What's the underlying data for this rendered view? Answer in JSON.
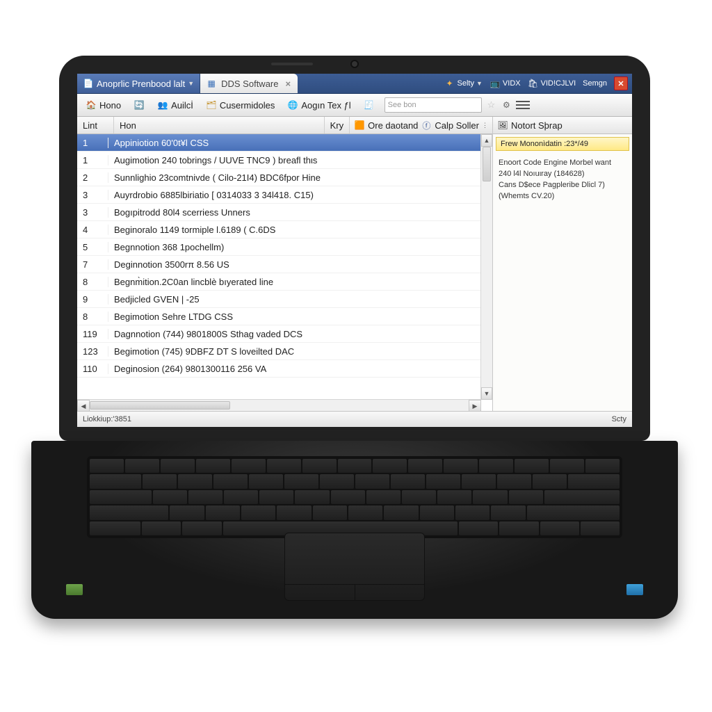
{
  "tabs": {
    "bg_label": "Anoprlic Prenbood lalt",
    "active_label": "DDS Software",
    "right_items": [
      "Selty",
      "VIDX",
      "VID!CJLVI",
      "Semgn"
    ]
  },
  "toolbar": {
    "home": "Hono",
    "audit": "Auilcİ",
    "customers": "Cusermidoles",
    "agentext": "Aogın Tex ƒl",
    "search_placeholder": "See bon"
  },
  "grid": {
    "headers": {
      "col1": "Lint",
      "col2": "Hon",
      "key": "Kry",
      "ore": "Ore daotand",
      "calp": "Calp Soller"
    },
    "rows": [
      {
        "n": "1",
        "t": "Appiniotion 60'0t¥l CSS",
        "sel": true
      },
      {
        "n": "1",
        "t": "Augimotion 240 tobrings / UUVE TNC9 ) breafl thιs"
      },
      {
        "n": "2",
        "t": "Sunnlighio 23comtnivde ( Cilo-21I4) BDC6fpor Hine"
      },
      {
        "n": "3",
        "t": "Auyrdrobio 6885lbiriatio [ 0314033 3 34l418. C15)"
      },
      {
        "n": "3",
        "t": "Bogıpitrodd 80l4 scerriess Unners"
      },
      {
        "n": "4",
        "t": "Beginoralo 1149 tormiple l.6189 ( C.6DS"
      },
      {
        "n": "5",
        "t": "Begnnotion 368 1pochellm)"
      },
      {
        "n": "7",
        "t": "Deginnotion 3500rπ 8.56 US"
      },
      {
        "n": "8",
        "t": "Begnm̀ition.2C0an lincblè bıyerated line"
      },
      {
        "n": "9",
        "t": "Bedjicled GVEN | -25"
      },
      {
        "n": "8",
        "t": "Begimotion Sehre LTDG CSS"
      },
      {
        "n": "119",
        "t": "Dagnnotion (744) 9801800S Sthag vaded DCS"
      },
      {
        "n": "123",
        "t": "Begimotion (745) 9DBFZ DT S loveilted DAC"
      },
      {
        "n": "110",
        "t": "Deginosion (264) 9801300116 256 VA"
      }
    ]
  },
  "side": {
    "title": "Notort Sþrap",
    "banner": "Frew Mononìdatin :23*/49",
    "body_lines": [
      "Enoort Code Engine Morbel want",
      "240 l4l Noıuιray (184628)",
      "Cans D$ece Pagpleribe Dlicl 7)",
      "(Whemts CV.20)"
    ]
  },
  "status": {
    "left": "Liokkiup:'3851",
    "right": "Scty"
  }
}
